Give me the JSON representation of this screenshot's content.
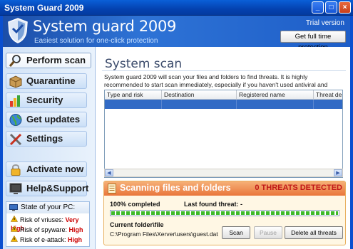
{
  "window": {
    "title": "System Guard 2009",
    "buttons": {
      "minimize": "_",
      "maximize": "□",
      "close": "×"
    }
  },
  "header": {
    "app_name": "System guard 2009",
    "tagline": "Easiest solution for one-click protection",
    "trial_label": "Trial version",
    "get_full_button": "Get full time protection"
  },
  "sidebar": {
    "items": [
      {
        "label": "Perform scan",
        "icon": "magnifier-icon",
        "active": true
      },
      {
        "label": "Quarantine",
        "icon": "box-icon"
      },
      {
        "label": "Security",
        "icon": "bar-chart-icon"
      },
      {
        "label": "Get updates",
        "icon": "globe-icon"
      },
      {
        "label": "Settings",
        "icon": "tools-icon"
      },
      {
        "label": "Activate now",
        "icon": "lock-icon"
      },
      {
        "label": "Help&Support",
        "icon": "monitor-icon"
      }
    ],
    "state": {
      "heading": "State of your PC:",
      "risks": [
        {
          "label": "Risk of vriuses:",
          "level": "Very high"
        },
        {
          "label": "Risk of spyware:",
          "level": "High"
        },
        {
          "label": "Risk of e-attack:",
          "level": "High"
        }
      ]
    }
  },
  "main": {
    "title": "System scan",
    "description": "System guard 2009 will scan your files and folders to find threats. It is highly recommended to start scan immediately, especially if you haven't used antiviral and antispyware software before.",
    "table": {
      "columns": [
        "Type and risk",
        "Destination",
        "Registered name",
        "Threat de"
      ]
    },
    "scan": {
      "title": "Scanning files and folders",
      "threats": "0 THREATS DETECTED",
      "completed": "100% completed",
      "progress": 1.0,
      "last_threat": "Last found threat: -",
      "current_label": "Current folder\\file",
      "current_path": "C:\\Program Files\\Xerver\\users\\guest.dat",
      "buttons": {
        "scan": "Scan",
        "pause": "Pause",
        "delete": "Delete all threats"
      }
    }
  },
  "colors": {
    "titlebar": "#0a5fd8",
    "header": "#2e73d6",
    "threat_red": "#c01818",
    "risk_red": "#cc0000",
    "selection": "#316ac5",
    "progress_green": "#3fba2a"
  }
}
